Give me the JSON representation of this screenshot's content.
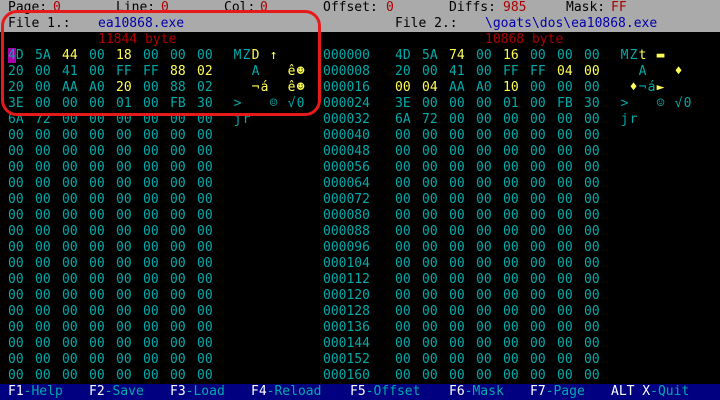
{
  "status": {
    "page_label": "Page:",
    "page_value": "0",
    "line_label": "Line:",
    "line_value": "0",
    "col_label": "Col:",
    "col_value": "0",
    "offset_label": "Offset:",
    "offset_value": "0",
    "diffs_label": "Diffs:",
    "diffs_value": "985",
    "mask_label": "Mask:",
    "mask_value": "FF"
  },
  "file1": {
    "label": "File 1.:",
    "name": "ea10868.exe",
    "size": "11844 byte"
  },
  "file2": {
    "label": "File 2.:",
    "name": "\\goats\\dos\\ea10868.exe",
    "size": "10868 byte"
  },
  "offsets": [
    "000000",
    "000008",
    "000016",
    "000024",
    "000032",
    "000040",
    "000048",
    "000056",
    "000064",
    "000072",
    "000080",
    "000088",
    "000096",
    "000104",
    "000112",
    "000120",
    "000128",
    "000136",
    "000144",
    "000152",
    "000160"
  ],
  "left_hex": [
    [
      "4D",
      "5A",
      "44",
      "00",
      "18",
      "00",
      "00",
      "00"
    ],
    [
      "20",
      "00",
      "41",
      "00",
      "FF",
      "FF",
      "88",
      "02"
    ],
    [
      "20",
      "00",
      "AA",
      "A0",
      "20",
      "00",
      "88",
      "02"
    ],
    [
      "3E",
      "00",
      "00",
      "00",
      "01",
      "00",
      "FB",
      "30"
    ],
    [
      "6A",
      "72",
      "00",
      "00",
      "00",
      "00",
      "00",
      "00"
    ]
  ],
  "right_hex": [
    [
      "4D",
      "5A",
      "74",
      "00",
      "16",
      "00",
      "00",
      "00"
    ],
    [
      "20",
      "00",
      "41",
      "00",
      "FF",
      "FF",
      "04",
      "00"
    ],
    [
      "00",
      "04",
      "AA",
      "A0",
      "10",
      "00",
      "00",
      "00"
    ],
    [
      "3E",
      "00",
      "00",
      "00",
      "01",
      "00",
      "FB",
      "30"
    ],
    [
      "6A",
      "72",
      "00",
      "00",
      "00",
      "00",
      "00",
      "00"
    ]
  ],
  "zero_byte": "00",
  "left_ascii": [
    [
      {
        "c": "M",
        "y": false
      },
      {
        "c": "Z",
        "y": false
      },
      {
        "c": "D",
        "y": true
      },
      {
        "c": " ",
        "y": false
      },
      {
        "c": "↑",
        "y": true
      }
    ],
    [
      {
        "c": " ",
        "y": false
      },
      {
        "c": " ",
        "y": false
      },
      {
        "c": "A",
        "y": false
      },
      {
        "c": " ",
        "y": false
      },
      {
        "c": " ",
        "y": false
      },
      {
        "c": " ",
        "y": false
      },
      {
        "c": "ê",
        "y": true
      },
      {
        "c": "☻",
        "y": true
      }
    ],
    [
      {
        "c": " ",
        "y": false
      },
      {
        "c": " ",
        "y": false
      },
      {
        "c": "¬",
        "y": true
      },
      {
        "c": "á",
        "y": true
      },
      {
        "c": " ",
        "y": false
      },
      {
        "c": " ",
        "y": false
      },
      {
        "c": "ê",
        "y": true
      },
      {
        "c": "☻",
        "y": true
      }
    ],
    [
      {
        "c": ">",
        "y": false
      },
      {
        "c": " ",
        "y": false
      },
      {
        "c": " ",
        "y": false
      },
      {
        "c": " ",
        "y": false
      },
      {
        "c": "☺",
        "y": false
      },
      {
        "c": " ",
        "y": false
      },
      {
        "c": "√",
        "y": false
      },
      {
        "c": "0",
        "y": false
      }
    ],
    [
      {
        "c": "j",
        "y": false
      },
      {
        "c": "r",
        "y": false
      }
    ]
  ],
  "right_ascii": [
    [
      {
        "c": "M",
        "y": false
      },
      {
        "c": "Z",
        "y": false
      },
      {
        "c": "t",
        "y": true
      },
      {
        "c": " ",
        "y": false
      },
      {
        "c": "▬",
        "y": true
      }
    ],
    [
      {
        "c": " ",
        "y": false
      },
      {
        "c": " ",
        "y": false
      },
      {
        "c": "A",
        "y": false
      },
      {
        "c": " ",
        "y": false
      },
      {
        "c": " ",
        "y": false
      },
      {
        "c": " ",
        "y": false
      },
      {
        "c": "♦",
        "y": true
      }
    ],
    [
      {
        "c": " ",
        "y": false
      },
      {
        "c": "♦",
        "y": true
      },
      {
        "c": "¬",
        "y": false
      },
      {
        "c": "á",
        "y": false
      },
      {
        "c": "►",
        "y": true
      }
    ],
    [
      {
        "c": ">",
        "y": false
      },
      {
        "c": " ",
        "y": false
      },
      {
        "c": " ",
        "y": false
      },
      {
        "c": " ",
        "y": false
      },
      {
        "c": "☺",
        "y": false
      },
      {
        "c": " ",
        "y": false
      },
      {
        "c": "√",
        "y": false
      },
      {
        "c": "0",
        "y": false
      }
    ],
    [
      {
        "c": "j",
        "y": false
      },
      {
        "c": "r",
        "y": false
      }
    ]
  ],
  "left_highlights": [
    [
      false,
      false,
      true,
      false,
      true,
      false,
      false,
      false
    ],
    [
      false,
      false,
      false,
      false,
      false,
      false,
      true,
      true
    ],
    [
      false,
      false,
      false,
      false,
      true,
      false,
      false,
      false
    ],
    [
      false,
      false,
      false,
      false,
      false,
      false,
      false,
      false
    ],
    [
      false,
      false,
      false,
      false,
      false,
      false,
      false,
      false
    ]
  ],
  "right_highlights": [
    [
      false,
      false,
      true,
      false,
      true,
      false,
      false,
      false
    ],
    [
      false,
      false,
      false,
      false,
      false,
      false,
      true,
      true
    ],
    [
      true,
      true,
      false,
      false,
      true,
      false,
      false,
      false
    ],
    [
      false,
      false,
      false,
      false,
      false,
      false,
      false,
      false
    ],
    [
      false,
      false,
      false,
      false,
      false,
      false,
      false,
      false
    ]
  ],
  "fkeys": [
    {
      "key": "F1",
      "desc": "-Help"
    },
    {
      "key": "F2",
      "desc": "-Save"
    },
    {
      "key": "F3",
      "desc": "-Load"
    },
    {
      "key": "F4",
      "desc": "-Reload"
    },
    {
      "key": "F5",
      "desc": "-Offset"
    },
    {
      "key": "F6",
      "desc": "-Mask"
    },
    {
      "key": "F7",
      "desc": "-Page"
    },
    {
      "key": "ALT X",
      "desc": "-Quit"
    }
  ],
  "colors": {
    "bg": "#000000",
    "cyan": "#00aaaa",
    "yellow": "#ffff55",
    "status_bg": "#aaaaaa",
    "fn_bg": "#000080",
    "annotation": "#e61a1a"
  }
}
